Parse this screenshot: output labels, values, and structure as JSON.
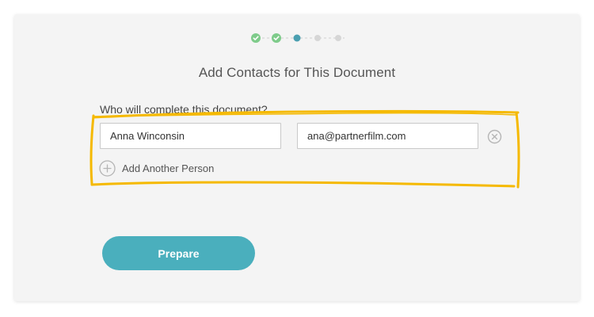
{
  "stepper": {
    "steps": [
      {
        "state": "done"
      },
      {
        "state": "done"
      },
      {
        "state": "current"
      },
      {
        "state": "pending"
      },
      {
        "state": "pending"
      }
    ],
    "colors": {
      "done": "#7ecb8a",
      "current": "#4a9fb0",
      "pending": "#d6d6d6",
      "connector": "#cfcfcf"
    }
  },
  "title": "Add Contacts for This Document",
  "question": "Who will complete this document?",
  "contact": {
    "name_value": "Anna Winconsin",
    "email_value": "ana@partnerfilm.com"
  },
  "add_person_label": "Add Another Person",
  "prepare_label": "Prepare",
  "colors": {
    "accent": "#4aafbd",
    "highlight": "#f5b900"
  }
}
